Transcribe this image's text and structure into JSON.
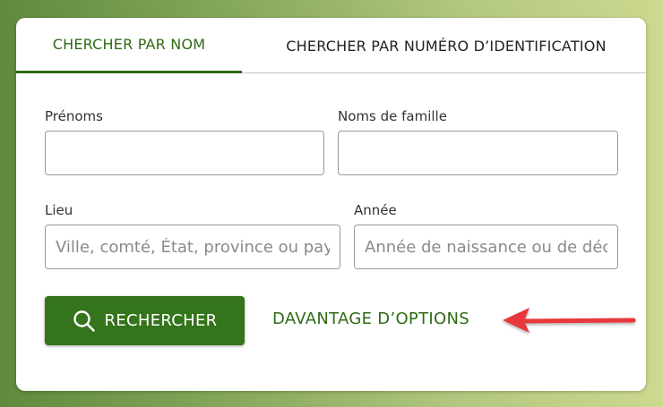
{
  "tabs": {
    "by_name": "CHERCHER PAR NOM",
    "by_id": "CHERCHER PAR NUMÉRO D’IDENTIFICATION"
  },
  "form": {
    "first_name_label": "Prénoms",
    "last_name_label": "Noms de famille",
    "place_label": "Lieu",
    "place_placeholder": "Ville, comté, État, province ou pays",
    "year_label": "Année",
    "year_placeholder": "Année de naissance ou de décès"
  },
  "actions": {
    "search_label": "RECHERCHER",
    "more_options_label": "DAVANTAGE D’OPTIONS"
  },
  "colors": {
    "accent": "#2e6b16",
    "button": "#34741b",
    "arrow": "#e8373d"
  },
  "icons": {
    "search": "search-icon",
    "annotation": "arrow-annotation"
  }
}
